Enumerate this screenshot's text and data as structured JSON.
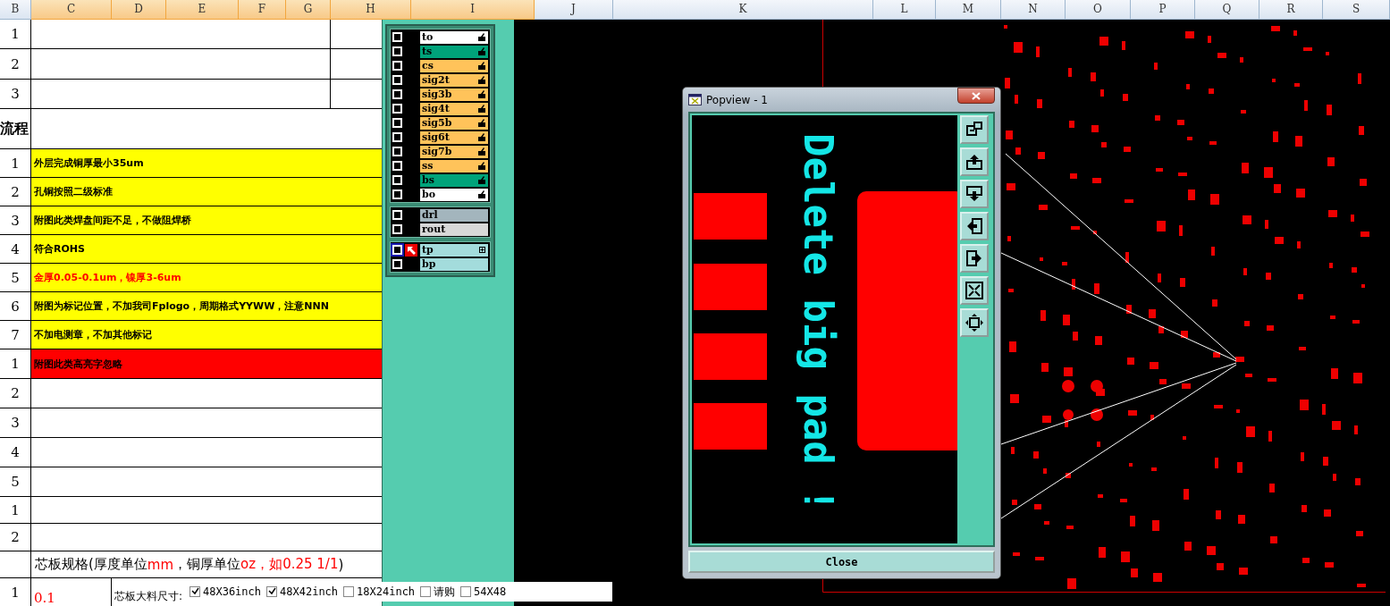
{
  "columns": [
    {
      "label": "B",
      "selected": false
    },
    {
      "label": "C",
      "selected": true
    },
    {
      "label": "D",
      "selected": true
    },
    {
      "label": "E",
      "selected": true
    },
    {
      "label": "F",
      "selected": true
    },
    {
      "label": "G",
      "selected": true
    },
    {
      "label": "H",
      "selected": true
    },
    {
      "label": "I",
      "selected": true
    },
    {
      "label": "J",
      "selected": false
    },
    {
      "label": "K",
      "selected": false
    },
    {
      "label": "L",
      "selected": false
    },
    {
      "label": "M",
      "selected": false
    },
    {
      "label": "N",
      "selected": false
    },
    {
      "label": "O",
      "selected": false
    },
    {
      "label": "P",
      "selected": false
    },
    {
      "label": "Q",
      "selected": false
    },
    {
      "label": "R",
      "selected": false
    },
    {
      "label": "S",
      "selected": false
    }
  ],
  "rows": [
    {
      "header": "1",
      "kind": "split"
    },
    {
      "header": "2",
      "kind": "split"
    },
    {
      "header": "3",
      "kind": "split"
    },
    {
      "header": "流程",
      "kind": "blank"
    },
    {
      "header": "1",
      "kind": "note",
      "text": "外层完成铜厚最小35um",
      "emphasis": false
    },
    {
      "header": "2",
      "kind": "note",
      "text": "孔铜按照二级标准",
      "emphasis": false
    },
    {
      "header": "3",
      "kind": "note",
      "text": "附图此类焊盘间距不足，不做阻焊桥",
      "emphasis": false
    },
    {
      "header": "4",
      "kind": "note",
      "text": "符合ROHS",
      "emphasis": false
    },
    {
      "header": "5",
      "kind": "note",
      "text": "金厚0.05-0.1um，镍厚3-6um",
      "emphasis": true
    },
    {
      "header": "6",
      "kind": "note",
      "text": "附图为标记位置，不加我司Fplogo，周期格式YYWW，注意NNN",
      "emphasis": false
    },
    {
      "header": "7",
      "kind": "note",
      "text": "不加电测章，不加其他标记",
      "emphasis": false
    },
    {
      "header": "1",
      "kind": "alert",
      "text": "附图此类高亮字忽略"
    },
    {
      "header": "2",
      "kind": "blank"
    },
    {
      "header": "3",
      "kind": "blank"
    },
    {
      "header": "4",
      "kind": "blank"
    },
    {
      "header": "5",
      "kind": "blank"
    },
    {
      "header": "1",
      "kind": "blank"
    },
    {
      "header": "2",
      "kind": "blank"
    }
  ],
  "core_spec": {
    "title": [
      {
        "text": "芯板规格(厚度单位",
        "emphasis": false
      },
      {
        "text": "mm",
        "emphasis": true
      },
      {
        "text": "，铜厚单位",
        "emphasis": false
      },
      {
        "text": "oz，如0.25 1/1",
        "emphasis": true
      },
      {
        "text": ")",
        "emphasis": false
      }
    ],
    "row_header": "1",
    "thickness": "0.1",
    "size_label": "芯板大料尺寸:",
    "sizes": [
      {
        "label": "48X36inch",
        "checked": true
      },
      {
        "label": "48X42inch",
        "checked": true
      },
      {
        "label": "18X24inch",
        "checked": false
      },
      {
        "label": "请购",
        "checked": false
      },
      {
        "label": "54X48",
        "checked": false
      }
    ]
  },
  "layer_groups": [
    {
      "layers": [
        {
          "name": "to",
          "color": "#ffffff",
          "kind": "hand",
          "active": false,
          "visible": false
        },
        {
          "name": "ts",
          "color": "#00a37a",
          "kind": "hand",
          "active": false,
          "visible": false
        },
        {
          "name": "cs",
          "color": "#ffc35a",
          "kind": "hand",
          "active": false,
          "visible": false
        },
        {
          "name": "sig2t",
          "color": "#ffc35a",
          "kind": "hand",
          "active": false,
          "visible": false
        },
        {
          "name": "sig3b",
          "color": "#ffc35a",
          "kind": "hand",
          "active": false,
          "visible": false
        },
        {
          "name": "sig4t",
          "color": "#ffc35a",
          "kind": "hand",
          "active": false,
          "visible": false
        },
        {
          "name": "sig5b",
          "color": "#ffc35a",
          "kind": "hand",
          "active": false,
          "visible": false
        },
        {
          "name": "sig6t",
          "color": "#ffc35a",
          "kind": "hand",
          "active": false,
          "visible": false
        },
        {
          "name": "sig7b",
          "color": "#ffc35a",
          "kind": "hand",
          "active": false,
          "visible": false
        },
        {
          "name": "ss",
          "color": "#ffc35a",
          "kind": "hand",
          "active": false,
          "visible": false
        },
        {
          "name": "bs",
          "color": "#00a37a",
          "kind": "hand",
          "active": false,
          "visible": false
        },
        {
          "name": "bo",
          "color": "#ffffff",
          "kind": "hand",
          "active": false,
          "visible": false
        }
      ]
    },
    {
      "layers": [
        {
          "name": "drl",
          "color": "#a3b5bd",
          "kind": "plain",
          "active": false,
          "visible": false
        },
        {
          "name": "rout",
          "color": "#d8d8d8",
          "kind": "plain",
          "active": false,
          "visible": false
        }
      ]
    },
    {
      "layers": [
        {
          "name": "tp",
          "color": "#a3dcdc",
          "kind": "expand",
          "active": true,
          "visible": false
        },
        {
          "name": "bp",
          "color": "#a3dcdc",
          "kind": "plain",
          "active": false,
          "visible": false
        }
      ]
    }
  ],
  "popview": {
    "title": "Popview - 1",
    "message": "Delete big pad !",
    "close_label": "Close"
  }
}
